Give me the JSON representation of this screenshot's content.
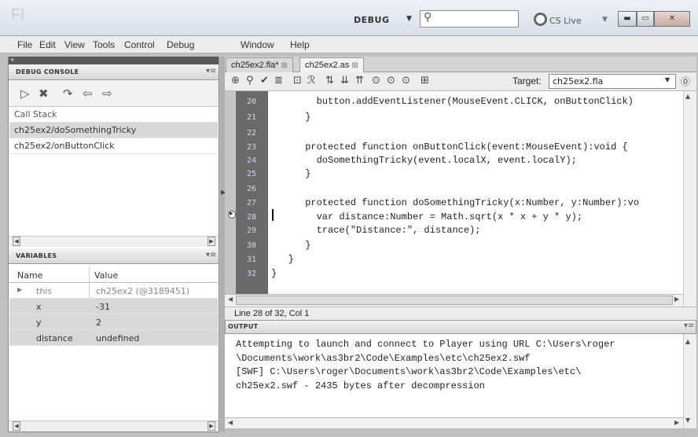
{
  "app": {
    "logo": "Fl",
    "workspace": "DEBUG",
    "cs_live": "CS Live"
  },
  "menu": [
    "File",
    "Edit",
    "View",
    "Tools",
    "Control",
    "Debug",
    "Window",
    "Help"
  ],
  "debug_console": {
    "title": "DEBUG CONSOLE",
    "call_stack_header": "Call Stack",
    "call_stack": [
      "ch25ex2/doSomethingTricky",
      "ch25ex2/onButtonClick"
    ]
  },
  "variables": {
    "title": "VARIABLES",
    "col_name": "Name",
    "col_value": "Value",
    "rows": [
      {
        "name": "this",
        "value": "ch25ex2 (@3189451)"
      },
      {
        "name": "x",
        "value": "-31"
      },
      {
        "name": "y",
        "value": "2"
      },
      {
        "name": "distance",
        "value": "undefined"
      }
    ]
  },
  "editor": {
    "tabs": [
      "ch25ex2.fla*",
      "ch25ex2.as"
    ],
    "target_label": "Target:",
    "target_value": "ch25ex2.fla",
    "lines": [
      {
        "n": "20",
        "code": "        button.addEventListener(MouseEvent.CLICK, onButtonClick)"
      },
      {
        "n": "21",
        "code": "      }"
      },
      {
        "n": "22",
        "code": ""
      },
      {
        "n": "23",
        "code": "      protected function onButtonClick(event:MouseEvent):void {"
      },
      {
        "n": "24",
        "code": "        doSomethingTricky(event.localX, event.localY);"
      },
      {
        "n": "25",
        "code": "      }"
      },
      {
        "n": "26",
        "code": ""
      },
      {
        "n": "27",
        "code": "      protected function doSomethingTricky(x:Number, y:Number):vo"
      },
      {
        "n": "28",
        "code": "        var distance:Number = Math.sqrt(x * x + y * y);"
      },
      {
        "n": "29",
        "code": "        trace(\"Distance:\", distance);"
      },
      {
        "n": "30",
        "code": "      }"
      },
      {
        "n": "31",
        "code": "   }"
      },
      {
        "n": "32",
        "code": "}"
      }
    ],
    "status": "Line 28 of 32, Col 1"
  },
  "output": {
    "title": "OUTPUT",
    "lines": [
      "Attempting to launch and connect to Player using URL C:\\Users\\roger",
      "\\Documents\\work\\as3br2\\Code\\Examples\\etc\\ch25ex2.swf",
      "[SWF] C:\\Users\\roger\\Documents\\work\\as3br2\\Code\\Examples\\etc\\",
      "ch25ex2.swf - 2435 bytes after decompression"
    ]
  }
}
